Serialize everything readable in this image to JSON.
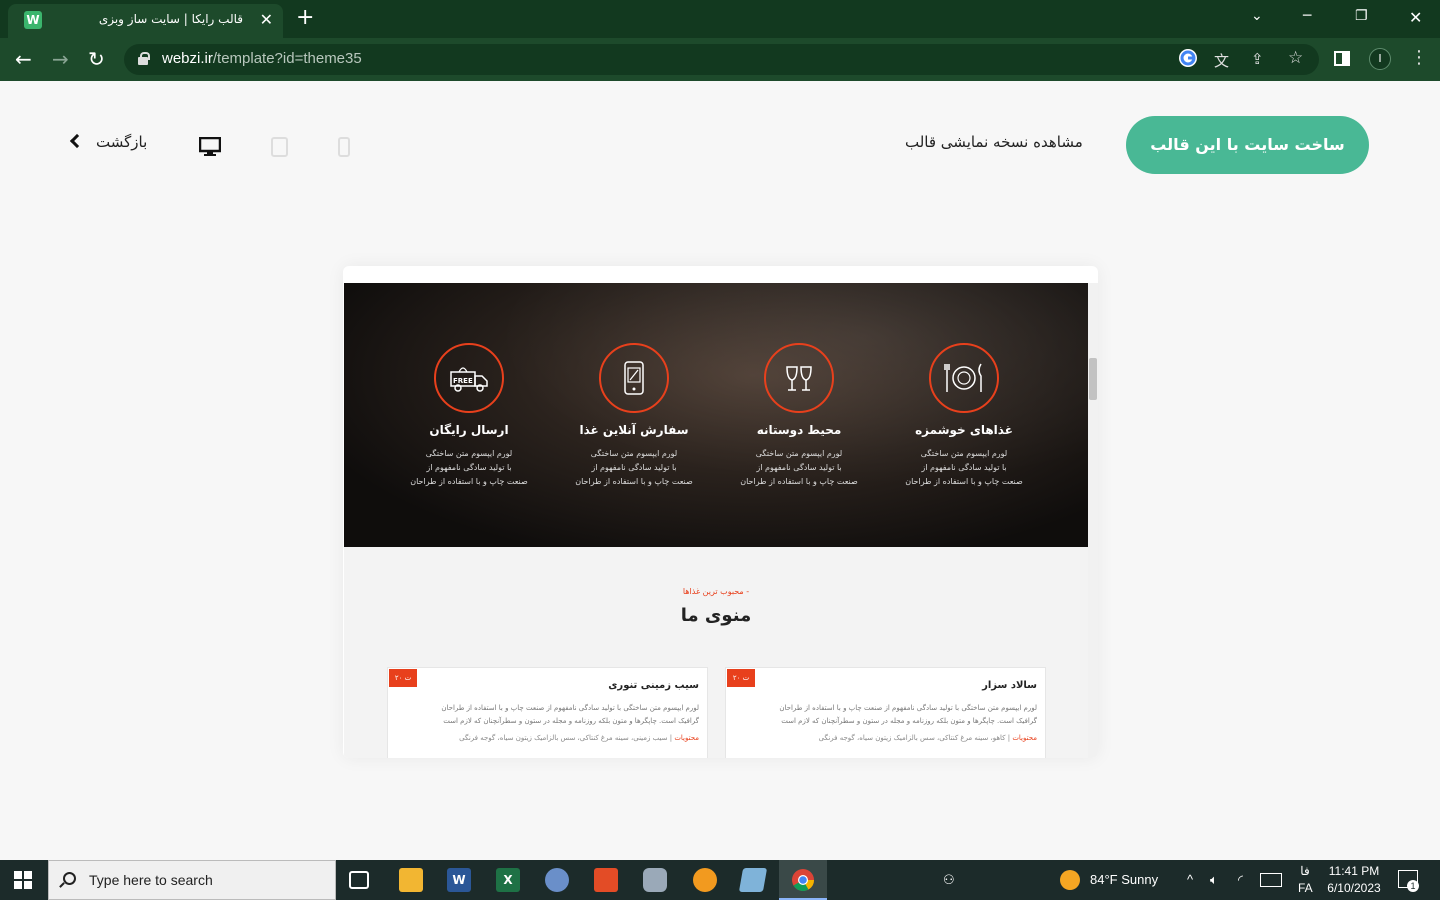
{
  "browser": {
    "tab_title": "قالب رایکا | سایت ساز وبزی",
    "favicon_letter": "W",
    "url_host": "webzi.ir",
    "url_path": "/template?id=theme35",
    "profile_initial": "I"
  },
  "header": {
    "cta_label": "ساخت سایت با این قالب",
    "demo_label": "مشاهده نسخه نمایشی قالب",
    "back_label": "بازگشت",
    "devices": [
      "desktop-icon",
      "tablet-icon",
      "mobile-icon"
    ],
    "active_device": "desktop"
  },
  "preview": {
    "features": [
      {
        "title": "غذاهای خوشمزه",
        "icon": "plate-icon",
        "lines": [
          "لورم ایپسوم متن ساختگی",
          "با تولید سادگی نامفهوم از",
          "صنعت چاپ و با استفاده از طراحان"
        ]
      },
      {
        "title": "محیط دوستانه",
        "icon": "glasses-icon",
        "lines": [
          "لورم ایپسوم متن ساختگی",
          "با تولید سادگی نامفهوم از",
          "صنعت چاپ و با استفاده از طراحان"
        ]
      },
      {
        "title": "سفارش آنلاین غذا",
        "icon": "phone-order-icon",
        "lines": [
          "لورم ایپسوم متن ساختگی",
          "با تولید سادگی نامفهوم از",
          "صنعت چاپ و با استفاده از طراحان"
        ]
      },
      {
        "title": "ارسال رایگان",
        "icon": "free-delivery-icon",
        "lines": [
          "لورم ایپسوم متن ساختگی",
          "با تولید سادگی نامفهوم از",
          "صنعت چاپ و با استفاده از طراحان"
        ]
      }
    ],
    "menu_kicker": "- محبوب ترین غذاها",
    "menu_title": "منوی ما",
    "cards": [
      {
        "title": "سالاد سزار",
        "price": "۲۰ ت",
        "desc": "لورم ایپسوم متن ساختگی با تولید سادگی نامفهوم از صنعت چاپ و با استفاده از طراحان گرافیک است. چاپگرها و متون بلکه روزنامه و مجله در ستون و سطرآنچنان که لازم است",
        "ing_label": "محتویات",
        "ingredients": "| کاهو، سینه مرغ کنتاکی، سس بالزامیک زیتون سیاه، گوجه فرنگی"
      },
      {
        "title": "سیب زمینی تنوری",
        "price": "۲۰ ت",
        "desc": "لورم ایپسوم متن ساختگی با تولید سادگی نامفهوم از صنعت چاپ و با استفاده از طراحان گرافیک است. چاپگرها و متون بلکه روزنامه و مجله در ستون و سطرآنچنان که لازم است",
        "ing_label": "محتویات",
        "ingredients": "| سیب زمینی، سینه مرغ کنتاکی، سس بالزامیک زیتون سیاه، گوجه فرنگی"
      }
    ]
  },
  "taskbar": {
    "search_placeholder": "Type here to search",
    "weather": "84°F  Sunny",
    "lang_top": "فا",
    "lang_bottom": "FA",
    "time": "11:41 PM",
    "date": "6/10/2023",
    "notification_count": "1"
  },
  "colors": {
    "brand_green": "#49b895",
    "accent_red": "#e8401c",
    "chrome_bg": "#1d4a2b"
  }
}
